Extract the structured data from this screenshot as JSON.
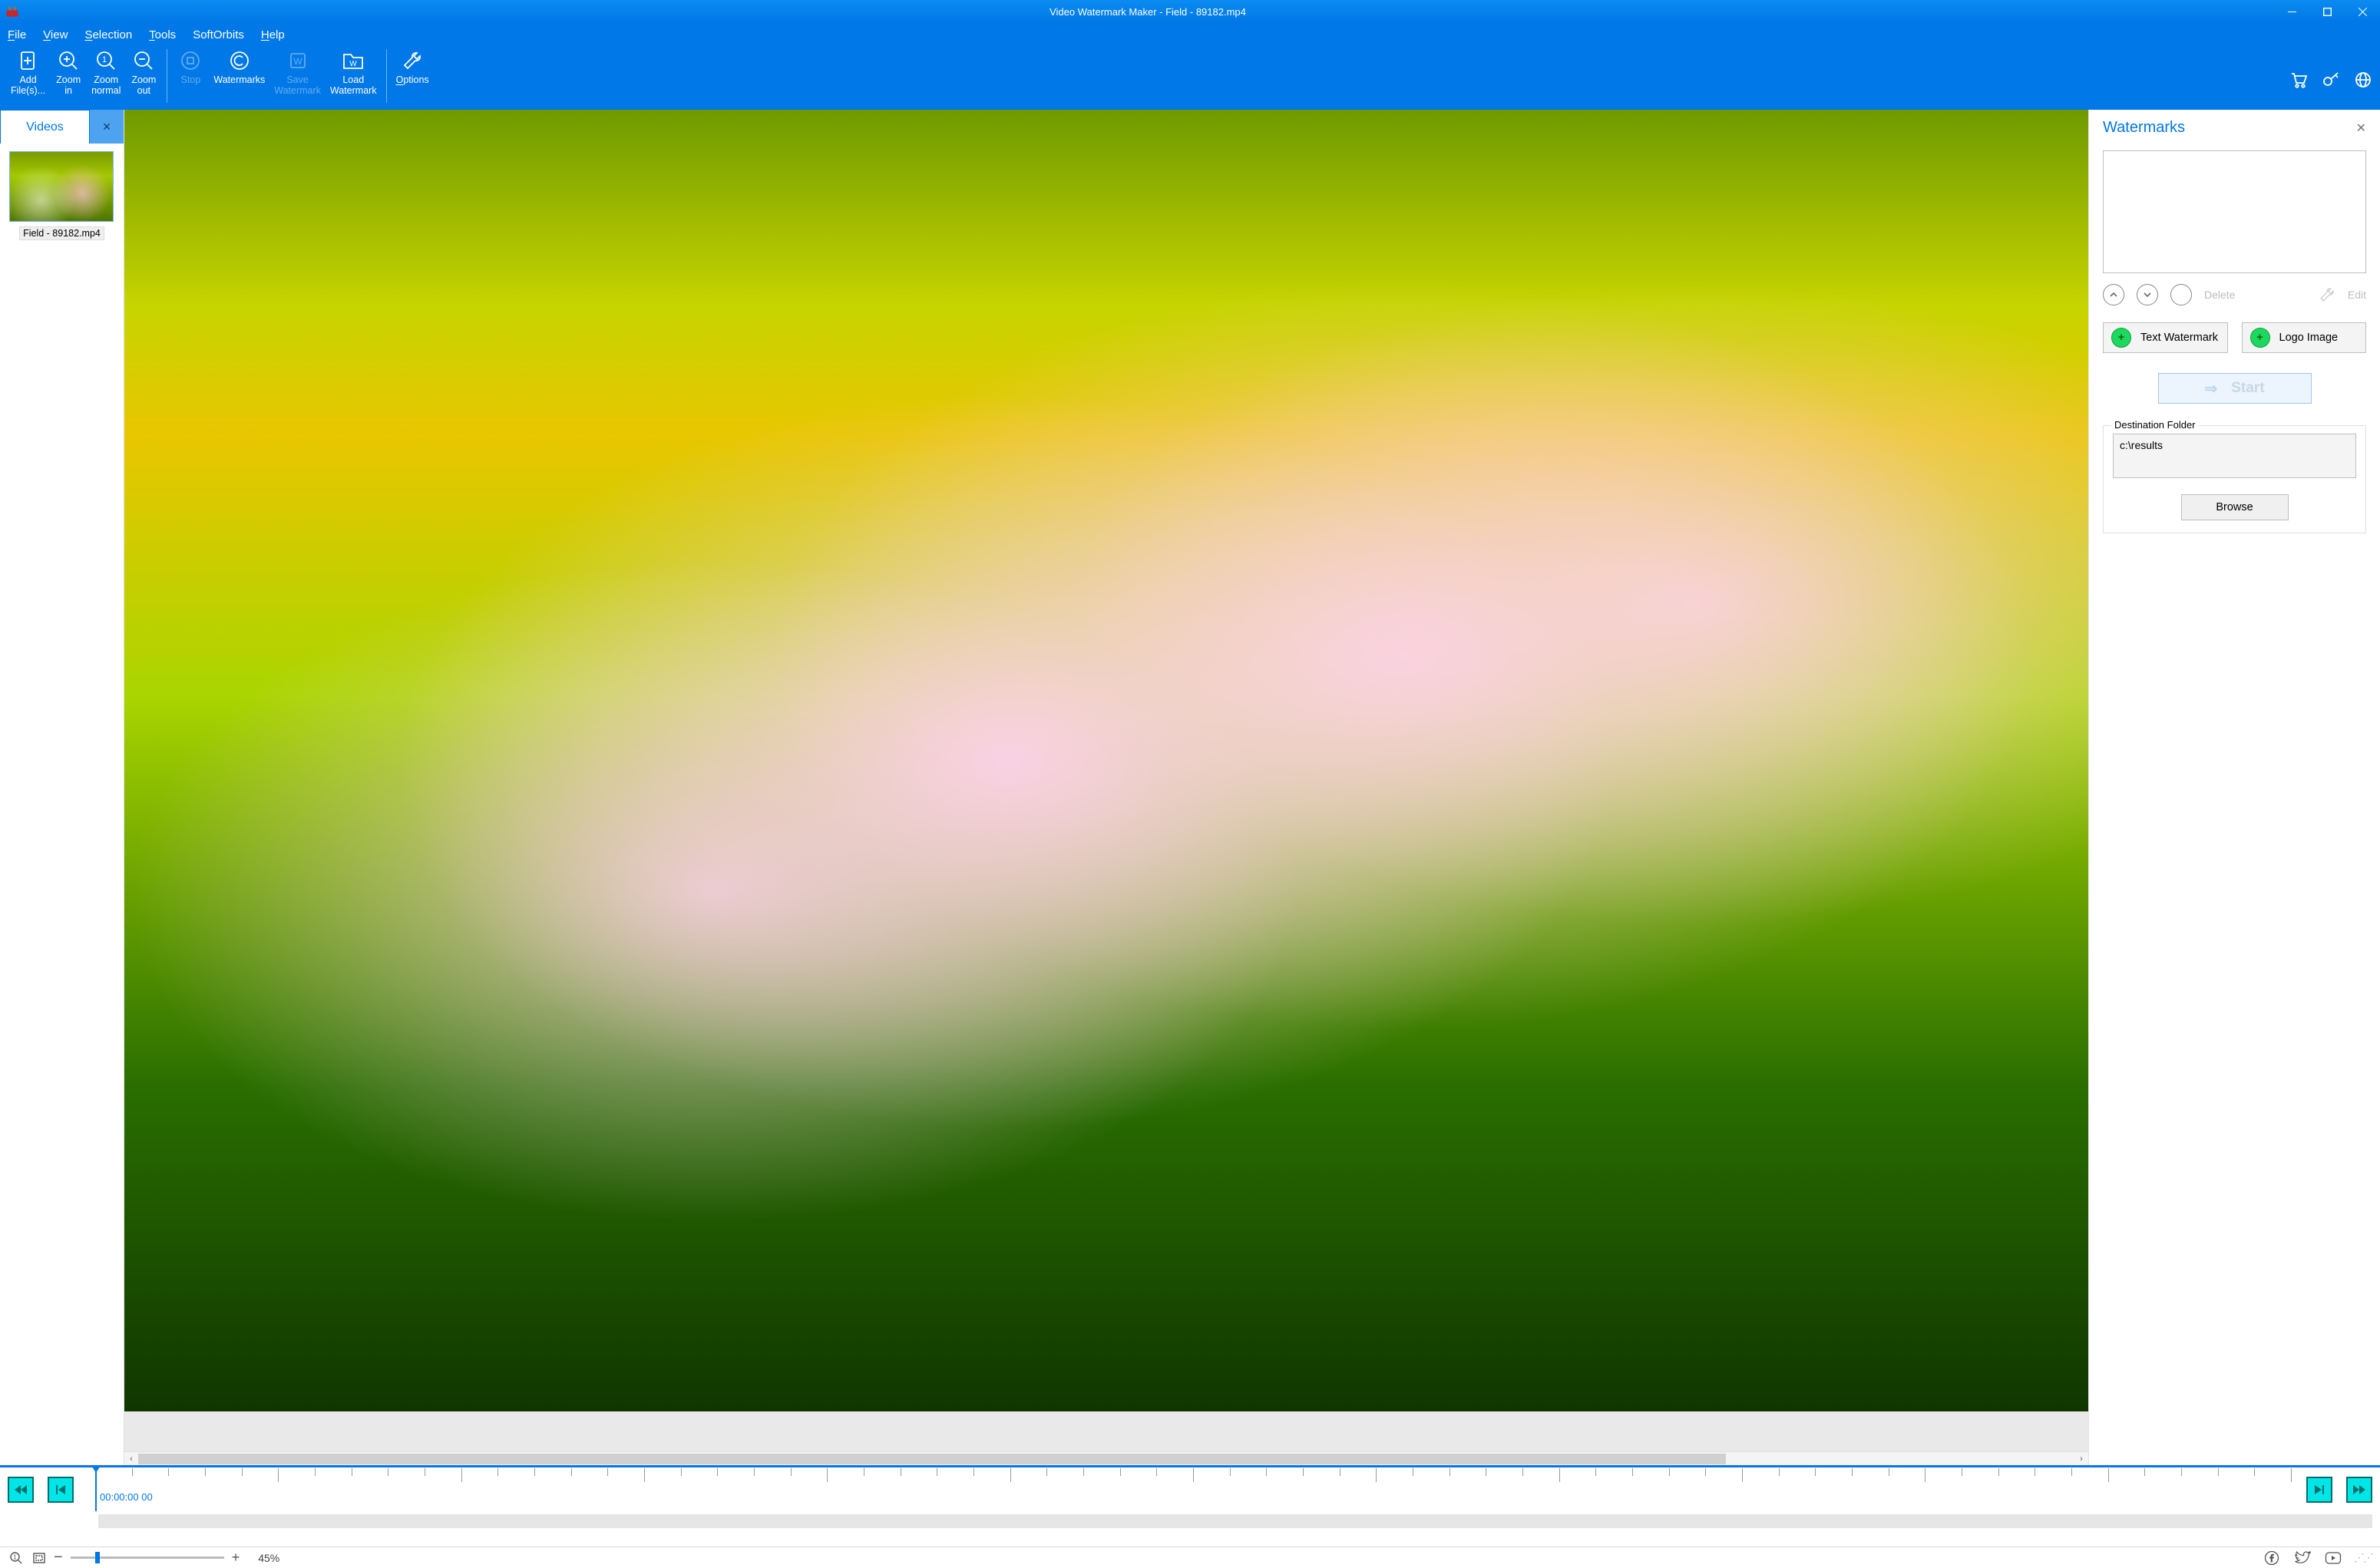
{
  "window": {
    "title": "Video Watermark Maker - Field - 89182.mp4"
  },
  "menubar": {
    "items": [
      {
        "hot": "F",
        "rest": "ile"
      },
      {
        "hot": "V",
        "rest": "iew"
      },
      {
        "hot": "S",
        "rest": "election"
      },
      {
        "hot": "T",
        "rest": "ools"
      },
      {
        "hot": "",
        "rest": "SoftOrbits"
      },
      {
        "hot": "H",
        "rest": "elp"
      }
    ]
  },
  "ribbon": {
    "add_files": "Add\nFile(s)...",
    "zoom_in": "Zoom\nin",
    "zoom_normal": "Zoom\nnormal",
    "zoom_out": "Zoom\nout",
    "stop": "Stop",
    "watermarks": "Watermarks",
    "save_wm": "Save\nWatermark",
    "load_wm": "Load\nWatermark",
    "options_hot": "O",
    "options_rest": "ptions"
  },
  "videos": {
    "tab_label": "Videos",
    "item_name": "Field - 89182.mp4"
  },
  "watermarks": {
    "header": "Watermarks",
    "delete": "Delete",
    "edit": "Edit",
    "text_btn": "Text Watermark",
    "logo_btn": "Logo Image",
    "start": "Start",
    "dest_legend": "Destination Folder",
    "dest_value": "c:\\results",
    "browse": "Browse"
  },
  "timeline": {
    "timecode": "00:00:00 00"
  },
  "status": {
    "zoom_pct": "45%"
  }
}
